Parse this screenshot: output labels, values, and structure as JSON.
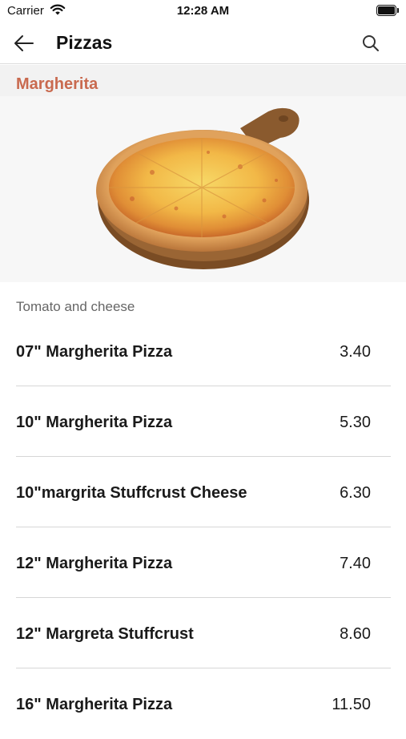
{
  "status_bar": {
    "carrier": "Carrier",
    "time": "12:28 AM",
    "icons": [
      "wifi-icon",
      "battery-icon"
    ]
  },
  "nav": {
    "title": "Pizzas",
    "back_icon": "arrow-left-icon",
    "search_icon": "search-icon"
  },
  "category": {
    "title": "Margherita",
    "accent_color": "#c96a4f",
    "description": "Tomato and cheese"
  },
  "items": [
    {
      "name": "07\" Margherita Pizza",
      "price": "3.40"
    },
    {
      "name": "10\" Margherita Pizza",
      "price": "5.30"
    },
    {
      "name": "10\"margrita Stuffcrust Cheese",
      "price": "6.30"
    },
    {
      "name": "12\" Margherita Pizza",
      "price": "7.40"
    },
    {
      "name": "12\" Margreta Stuffcrust",
      "price": "8.60"
    },
    {
      "name": "16\" Margherita Pizza",
      "price": "11.50"
    }
  ]
}
